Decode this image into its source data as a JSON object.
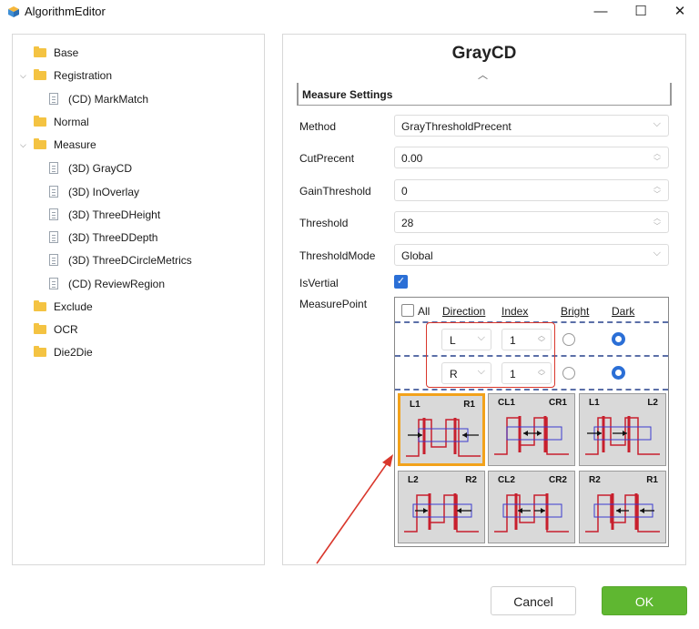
{
  "window": {
    "title": "AlgorithmEditor",
    "minimize": "—",
    "maximize": "☐",
    "close": "✕"
  },
  "tree": [
    {
      "label": "Base"
    },
    {
      "label": "Registration"
    },
    {
      "label": "(CD) MarkMatch"
    },
    {
      "label": "Normal"
    },
    {
      "label": "Measure"
    },
    {
      "label": "(3D) GrayCD"
    },
    {
      "label": "(3D) InOverlay"
    },
    {
      "label": "(3D) ThreeDHeight"
    },
    {
      "label": "(3D) ThreeDDepth"
    },
    {
      "label": "(3D) ThreeDCircleMetrics"
    },
    {
      "label": "(CD) ReviewRegion"
    },
    {
      "label": "Exclude"
    },
    {
      "label": "OCR"
    },
    {
      "label": "Die2Die"
    }
  ],
  "panel": {
    "title": "GrayCD",
    "section": "Measure Settings",
    "props": {
      "method": {
        "label": "Method",
        "value": "GrayThresholdPrecent"
      },
      "cut": {
        "label": "CutPrecent",
        "value": "0.00"
      },
      "gain": {
        "label": "GainThreshold",
        "value": "0"
      },
      "threshold": {
        "label": "Threshold",
        "value": "28"
      },
      "mode": {
        "label": "ThresholdMode",
        "value": "Global"
      },
      "vertial": {
        "label": "IsVertial"
      },
      "mp": {
        "label": "MeasurePoint"
      }
    },
    "measure_point": {
      "headers": {
        "all": "All",
        "direction": "Direction",
        "index": "Index",
        "bright": "Bright",
        "dark": "Dark"
      },
      "rows": [
        {
          "direction": "L",
          "index": "1"
        },
        {
          "direction": "R",
          "index": "1"
        }
      ],
      "tiles": [
        {
          "left": "L1",
          "right": "R1"
        },
        {
          "left": "CL1",
          "right": "CR1"
        },
        {
          "left": "L1",
          "right": "L2"
        },
        {
          "left": "L2",
          "right": "R2"
        },
        {
          "left": "CL2",
          "right": "CR2"
        },
        {
          "left": "R2",
          "right": "R1"
        }
      ]
    }
  },
  "buttons": {
    "cancel": "Cancel",
    "ok": "OK"
  },
  "colors": {
    "accent": "#2b6fd6",
    "ok": "#5fb731",
    "highlight": "#f2a21b",
    "annotation": "#d9372c",
    "folder": "#f4c342"
  }
}
